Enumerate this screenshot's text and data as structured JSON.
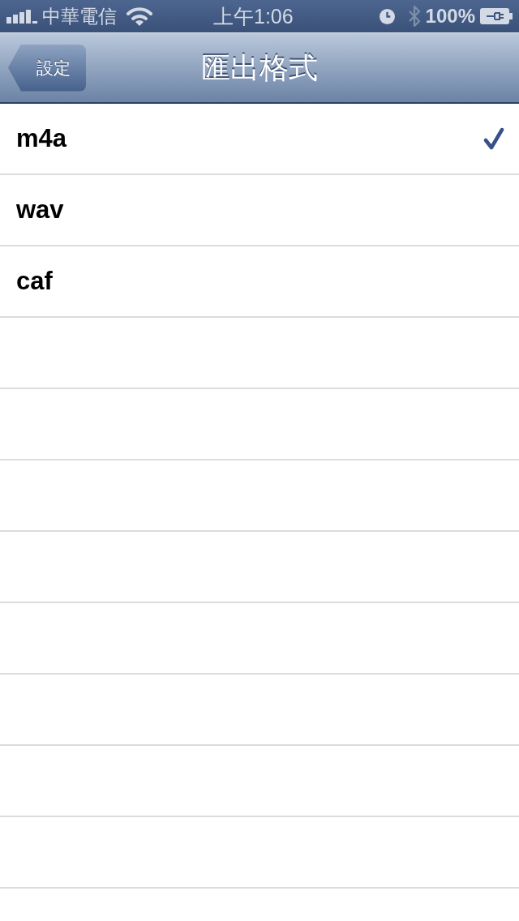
{
  "status_bar": {
    "carrier": "中華電信",
    "time": "上午1:06",
    "battery": "100%"
  },
  "nav_bar": {
    "back_button": "設定",
    "title": "匯出格式"
  },
  "options": [
    {
      "label": "m4a",
      "selected": true
    },
    {
      "label": "wav",
      "selected": false
    },
    {
      "label": "caf",
      "selected": false
    }
  ]
}
